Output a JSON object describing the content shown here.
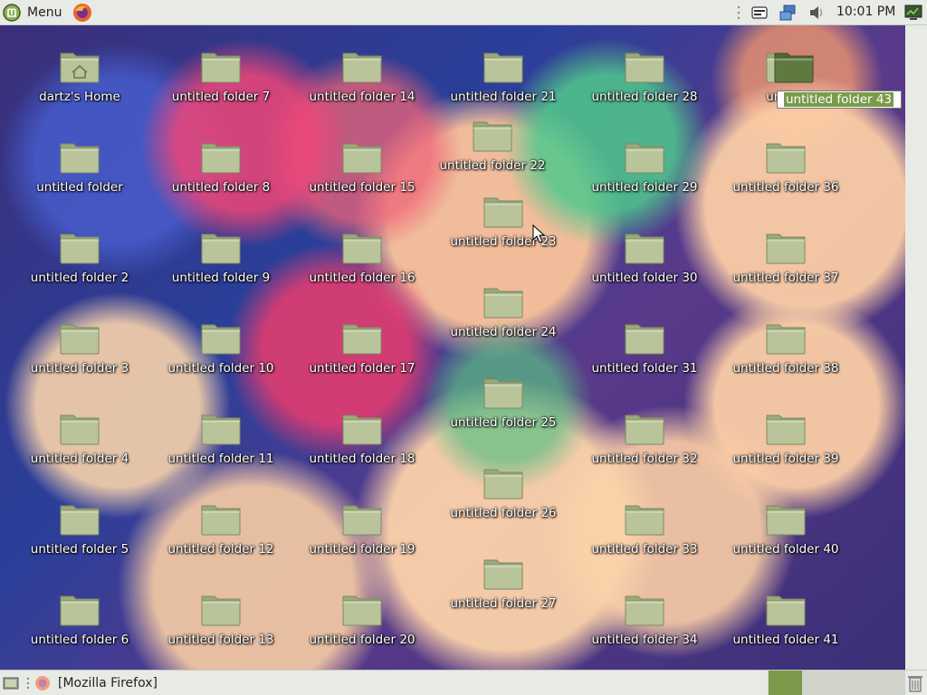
{
  "top_panel": {
    "menu_label": "Menu",
    "clock": "10:01 PM",
    "tray_icons": [
      "keyboard-icon",
      "network-icon",
      "volume-icon",
      "system-monitor-icon"
    ]
  },
  "desktop": {
    "icons": [
      {
        "label": "dartz's Home",
        "type": "home"
      },
      {
        "label": "untitled folder"
      },
      {
        "label": "untitled folder 2"
      },
      {
        "label": "untitled folder 3"
      },
      {
        "label": "untitled folder 4"
      },
      {
        "label": "untitled folder 5"
      },
      {
        "label": "untitled folder 6"
      },
      {
        "label": "untitled folder 7"
      },
      {
        "label": "untitled folder 8"
      },
      {
        "label": "untitled folder 9"
      },
      {
        "label": "untitled folder 10"
      },
      {
        "label": "untitled folder 11"
      },
      {
        "label": "untitled folder 12"
      },
      {
        "label": "untitled folder 13"
      },
      {
        "label": "untitled folder 14"
      },
      {
        "label": "untitled folder 15"
      },
      {
        "label": "untitled folder 16"
      },
      {
        "label": "untitled folder 17"
      },
      {
        "label": "untitled folder 18"
      },
      {
        "label": "untitled folder 19"
      },
      {
        "label": "untitled folder 20"
      },
      {
        "label": "untitled folder 21"
      },
      {
        "label": "untitled folder 22"
      },
      {
        "label": "untitled folder 23"
      },
      {
        "label": "untitled folder 24"
      },
      {
        "label": "untitled folder 25"
      },
      {
        "label": "untitled folder 26"
      },
      {
        "label": "untitled folder 27"
      },
      {
        "label": "untitled folder 28"
      },
      {
        "label": "untitled folder 29"
      },
      {
        "label": "untitled folder 30"
      },
      {
        "label": "untitled folder 31"
      },
      {
        "label": "untitled folder 32"
      },
      {
        "label": "untitled folder 33"
      },
      {
        "label": "untitled folder 34"
      },
      {
        "label": "untitled folder 36"
      },
      {
        "label": "untitled folder 37"
      },
      {
        "label": "untitled folder 38"
      },
      {
        "label": "untitled folder 39"
      },
      {
        "label": "untitled folder 40"
      },
      {
        "label": "untitled folder 41"
      },
      {
        "label": "untitle"
      }
    ],
    "rename_value": "untitled folder 43"
  },
  "bottom_panel": {
    "window_button_label": "[Mozilla Firefox]",
    "workspaces": [
      "workspace-1",
      "workspace-2",
      "workspace-3",
      "workspace-4"
    ]
  },
  "colors": {
    "folder_fill": "#b9c49a",
    "folder_dark": "#5f7a3e",
    "panel_bg": "#e8ebe5",
    "selection": "#7a9a4a"
  }
}
